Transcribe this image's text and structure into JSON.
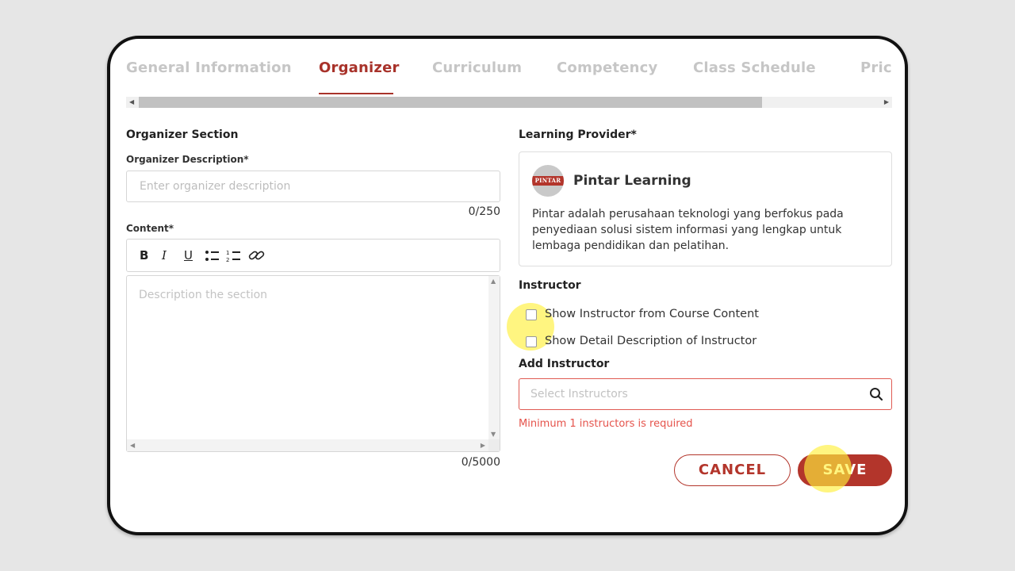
{
  "tabs": [
    {
      "label": "General Information",
      "active": false
    },
    {
      "label": "Organizer",
      "active": true
    },
    {
      "label": "Curriculum",
      "active": false
    },
    {
      "label": "Competency",
      "active": false
    },
    {
      "label": "Class Schedule",
      "active": false
    },
    {
      "label": "Pric",
      "active": false
    }
  ],
  "organizer": {
    "section_title": "Organizer Section",
    "description_label": "Organizer Description*",
    "description_placeholder": "Enter organizer description",
    "description_counter": "0/250",
    "content_label": "Content*",
    "content_placeholder": "Description the section",
    "content_counter": "0/5000",
    "toolbar": {
      "bold": "B",
      "italic": "I",
      "underline": "U",
      "bullet_list_icon": "bullet-list-icon",
      "numbered_list_icon": "numbered-list-icon",
      "link_icon": "link-icon"
    }
  },
  "provider": {
    "label": "Learning Provider*",
    "logo_text": "PINTAR",
    "name": "Pintar Learning",
    "description": "Pintar adalah perusahaan teknologi yang berfokus pada penyediaan solusi sistem informasi yang lengkap untuk lembaga pendidikan dan pelatihan."
  },
  "instructor": {
    "label": "Instructor",
    "checkbox_course": "Show Instructor from Course Content",
    "checkbox_detail": "Show Detail Description of Instructor",
    "add_label": "Add Instructor",
    "search_placeholder": "Select Instructors",
    "error": "Minimum 1 instructors is required"
  },
  "actions": {
    "cancel": "CANCEL",
    "save": "SAVE"
  },
  "colors": {
    "accent": "#b3352b",
    "error": "#e5534b",
    "tab_inactive": "#c6c6c6"
  }
}
